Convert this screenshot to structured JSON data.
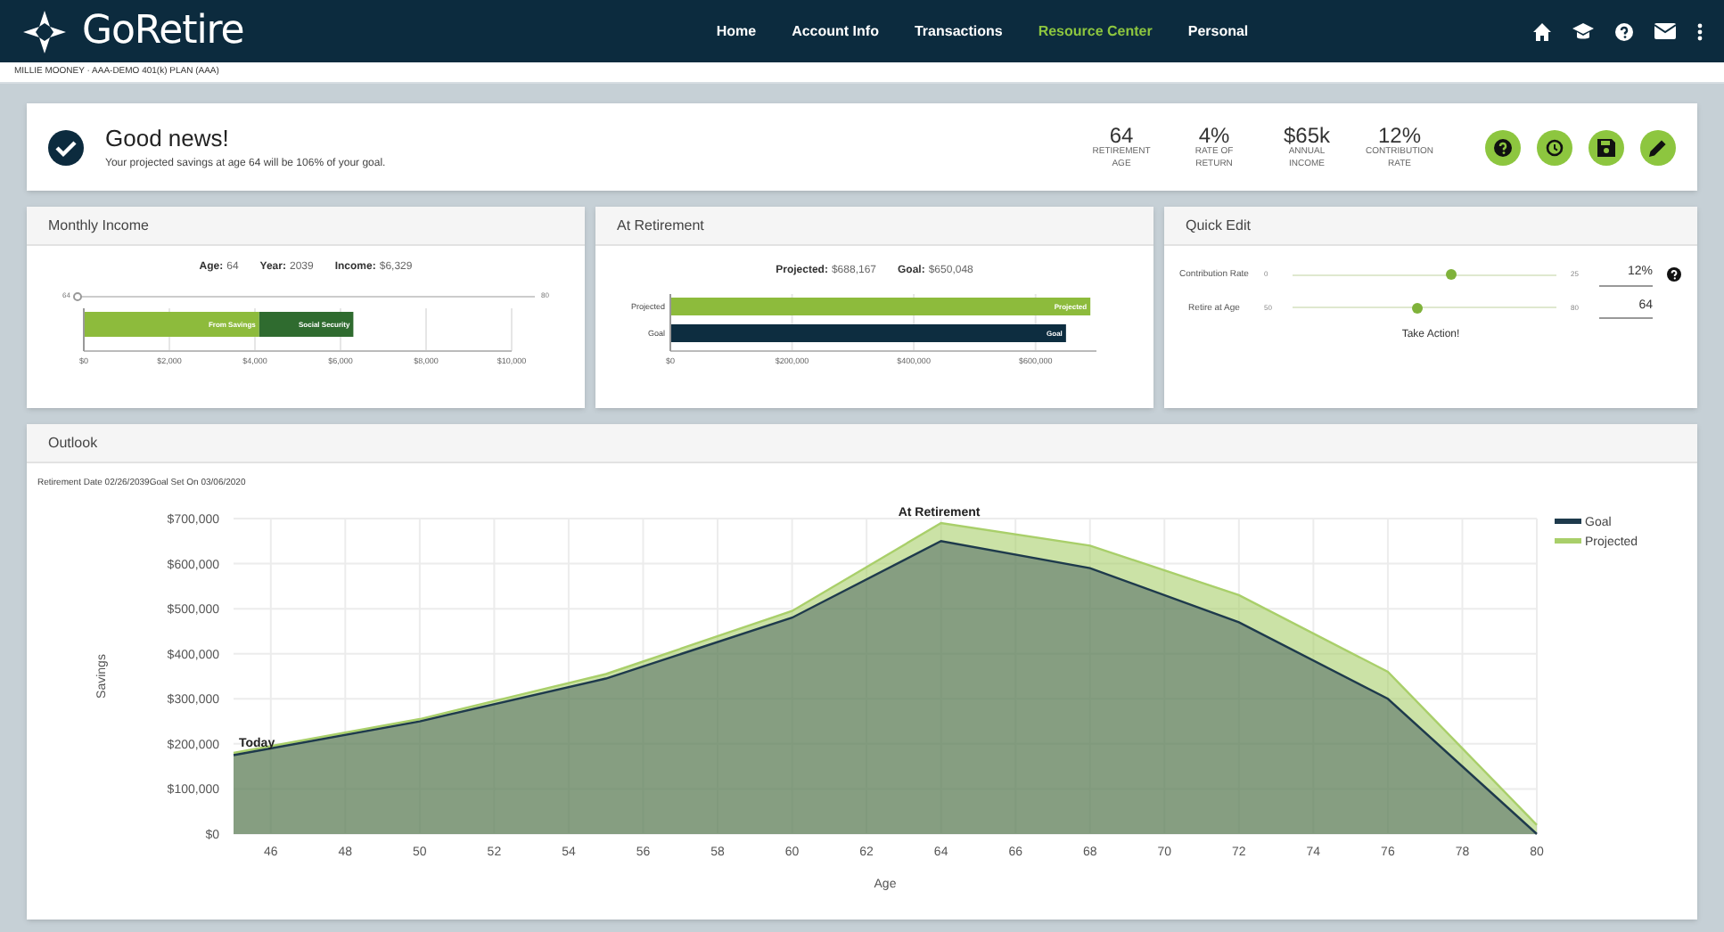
{
  "header": {
    "logo": "GoRetire",
    "nav": [
      {
        "label": "Home",
        "selected": false
      },
      {
        "label": "Account Info",
        "selected": false
      },
      {
        "label": "Transactions",
        "selected": false
      },
      {
        "label": "Resource Center",
        "selected": true
      },
      {
        "label": "Personal",
        "selected": false
      }
    ]
  },
  "account_line": "MILLIE MOONEY · AAA-DEMO 401(k) PLAN (AAA)",
  "summary": {
    "title": "Good news!",
    "message": "Your projected savings at age 64 will be 106% of your goal.",
    "stats": [
      {
        "value": "64",
        "label": "RETIREMENT AGE"
      },
      {
        "value": "4%",
        "label": "RATE OF RETURN"
      },
      {
        "value": "$65k",
        "label": "ANNUAL INCOME"
      },
      {
        "value": "12%",
        "label": "CONTRIBUTION RATE"
      }
    ]
  },
  "monthly_income": {
    "title": "Monthly Income",
    "age_label": "Age:",
    "age": "64",
    "year_label": "Year:",
    "year": "2039",
    "income_label": "Income:",
    "income": "$6,329",
    "slider": {
      "min": "64",
      "max": "80",
      "level": 0
    },
    "chart_data": {
      "type": "bar",
      "orientation": "horizontal",
      "stacked": true,
      "grid": true,
      "series": [
        {
          "name": "From Savings",
          "color": "#8dbb3c",
          "values": [
            4100
          ]
        },
        {
          "name": "Social Security",
          "color": "#2f6b2f",
          "values": [
            2200
          ]
        }
      ],
      "xlim": [
        0,
        10000
      ],
      "xticks": [
        {
          "value": 0,
          "label": "$0"
        },
        {
          "value": 2000,
          "label": "$2,000"
        },
        {
          "value": 4000,
          "label": "$4,000"
        },
        {
          "value": 6000,
          "label": "$6,000"
        },
        {
          "value": 8000,
          "label": "$8,000"
        },
        {
          "value": 10000,
          "label": "$10,000"
        }
      ]
    }
  },
  "at_retirement": {
    "title": "At Retirement",
    "projected_label": "Projected:",
    "projected": "$688,167",
    "goal_label": "Goal:",
    "goal": "$650,048",
    "chart_data": {
      "type": "bar",
      "orientation": "horizontal",
      "grid": true,
      "categories": [
        "Projected",
        "Goal"
      ],
      "series": [
        {
          "name": "Projected",
          "color": "#8dbb3c",
          "values": [
            690000,
            null
          ]
        },
        {
          "name": "Goal",
          "color": "#0d2d40",
          "values": [
            null,
            650000
          ]
        }
      ],
      "xlim": [
        0,
        700000
      ],
      "xticks": [
        {
          "value": 0,
          "label": "$0"
        },
        {
          "value": 200000,
          "label": "$200,000"
        },
        {
          "value": 400000,
          "label": "$400,000"
        },
        {
          "value": 600000,
          "label": "$600,000"
        }
      ]
    }
  },
  "quick_edit": {
    "title": "Quick Edit",
    "rows": [
      {
        "label": "Contribution Rate",
        "min": "0",
        "max": "25",
        "level": 0.6,
        "value": "12%",
        "help": true
      },
      {
        "label": "Retire at Age",
        "min": "50",
        "max": "80",
        "level": 0.47,
        "value": "64",
        "help": false
      }
    ],
    "action": "Take Action!"
  },
  "outlook": {
    "title": "Outlook",
    "info": "Retirement Date 02/26/2039Goal Set On 03/06/2020",
    "chart_data": {
      "type": "area",
      "grid": true,
      "legend": "right",
      "xlabel": "Age",
      "ylabel": "Savings",
      "x": [
        45,
        50,
        55,
        60,
        64,
        68,
        72,
        76,
        80
      ],
      "series": [
        {
          "name": "Goal",
          "color": "#1e3a4c",
          "values": [
            175000,
            250000,
            345000,
            480000,
            650000,
            590000,
            470000,
            300000,
            0
          ]
        },
        {
          "name": "Projected",
          "color": "#a9cf6a",
          "values": [
            180000,
            255000,
            355000,
            495000,
            690000,
            640000,
            530000,
            360000,
            20000
          ]
        }
      ],
      "xlim": [
        45,
        80
      ],
      "ylim": [
        0,
        700000
      ],
      "xticks": [
        46,
        48,
        50,
        52,
        54,
        56,
        58,
        60,
        62,
        64,
        66,
        68,
        70,
        72,
        74,
        76,
        78,
        80
      ],
      "yticks": [
        {
          "value": 0,
          "label": "$0"
        },
        {
          "value": 100000,
          "label": "$100,000"
        },
        {
          "value": 200000,
          "label": "$200,000"
        },
        {
          "value": 300000,
          "label": "$300,000"
        },
        {
          "value": 400000,
          "label": "$400,000"
        },
        {
          "value": 500000,
          "label": "$500,000"
        },
        {
          "value": 600000,
          "label": "$600,000"
        },
        {
          "value": 700000,
          "label": "$700,000"
        }
      ],
      "annotations": [
        "Today",
        "At Retirement"
      ]
    }
  }
}
